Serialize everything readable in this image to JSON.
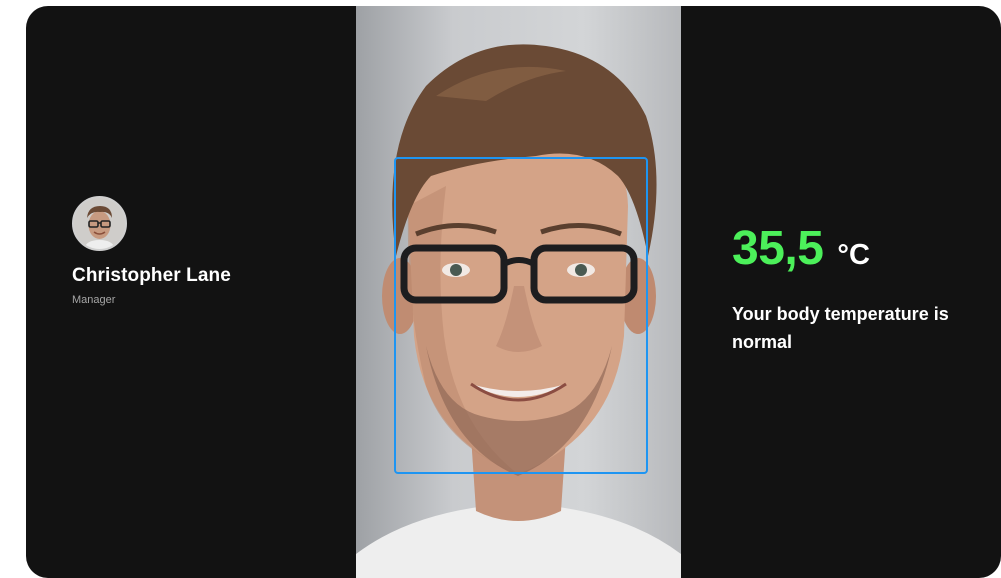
{
  "user": {
    "name": "Christopher Lane",
    "role": "Manager",
    "avatar_icon": "user-avatar"
  },
  "temperature": {
    "value": "35,5",
    "unit": "°C",
    "status_color": "#4cf05a",
    "message": "Your body temperature is normal"
  },
  "camera": {
    "frame_color": "#1e95f2"
  }
}
